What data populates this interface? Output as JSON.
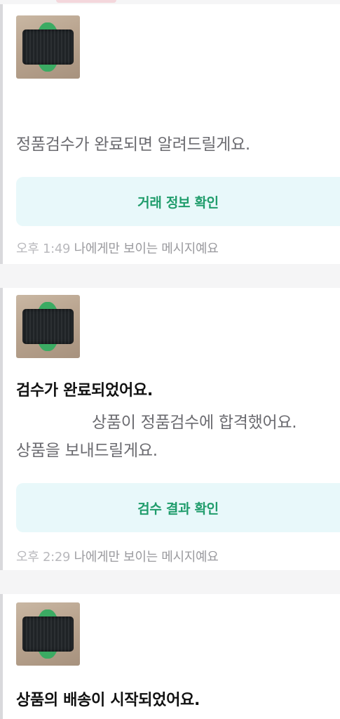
{
  "messages": [
    {
      "thumbnail_icon": "product-thumbnail",
      "text_lines": [
        "정품검수가 완료되면 알려드릴게요."
      ],
      "button_label": "거래 정보 확인",
      "time": "오후 1:49",
      "visibility_note": "나에게만 보이는 메시지예요"
    },
    {
      "thumbnail_icon": "product-thumbnail",
      "title": "검수가 완료되었어요.",
      "text_lines": [
        "상품이 정품검수에 합격했어요.",
        "상품을 보내드릴게요."
      ],
      "button_label": "검수 결과 확인",
      "time": "오후 2:29",
      "visibility_note": "나에게만 보이는 메시지예요"
    },
    {
      "thumbnail_icon": "product-thumbnail",
      "title": "상품의 배송이 시작되었어요."
    }
  ],
  "colors": {
    "button_text": "#1f9c6b",
    "button_bg": "#e8f8fa",
    "page_bg": "#f5f5f6"
  }
}
